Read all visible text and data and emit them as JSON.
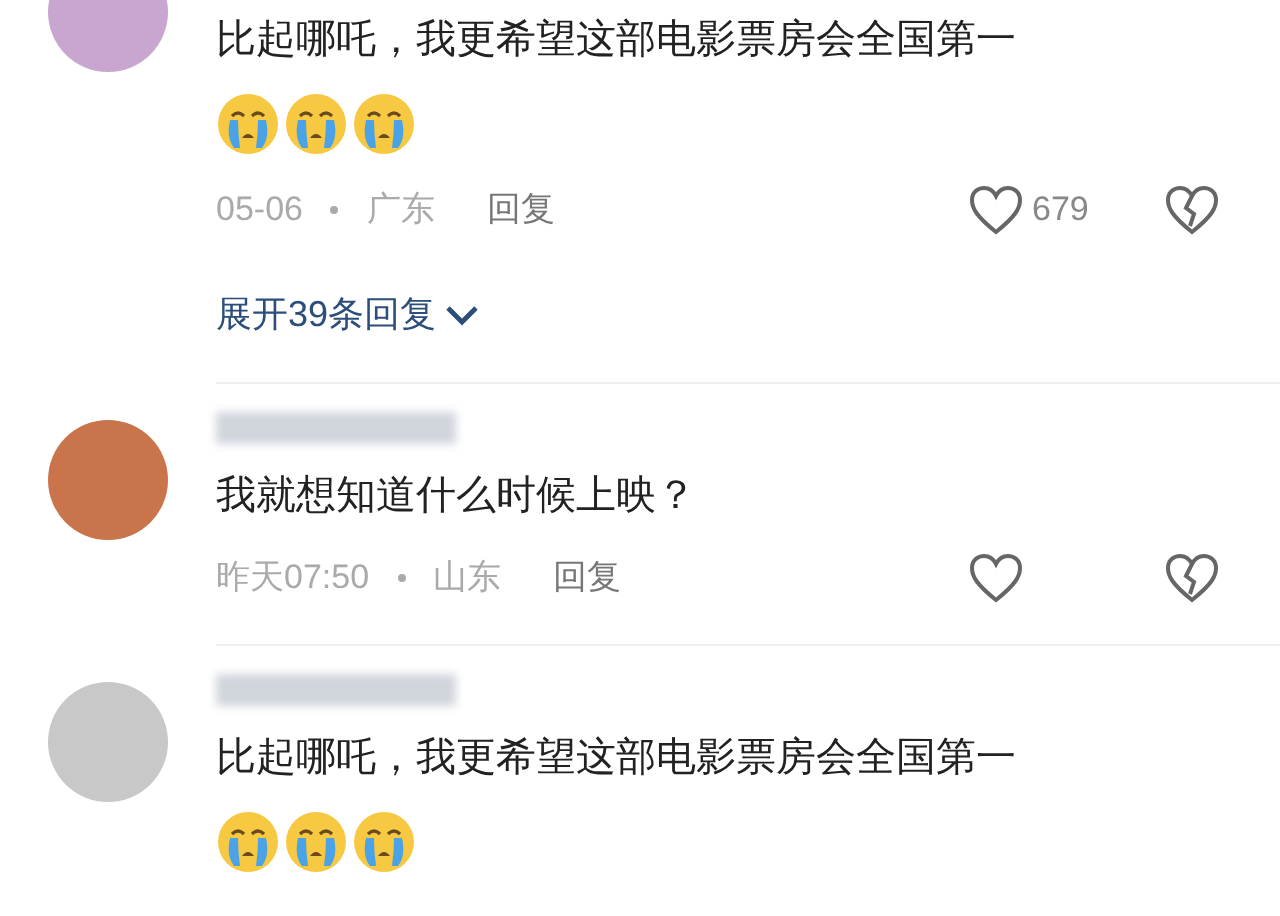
{
  "comments": [
    {
      "avatar": {
        "color": "#c9a6cf"
      },
      "text": "比起哪吒，我更希望这部电影票房会全国第一",
      "reactions": [
        {
          "kind": "crying"
        },
        {
          "kind": "crying"
        },
        {
          "kind": "crying"
        }
      ],
      "time": "05-06",
      "region": "广东",
      "reply": "回复",
      "likes": "679",
      "expand": "展开39条回复"
    },
    {
      "avatar": {
        "color": "#c9744a"
      },
      "text": "我就想知道什么时候上映？",
      "time": "昨天07:50",
      "region": "山东",
      "reply": "回复"
    },
    {
      "avatar": {
        "color": "#c8c8c8"
      },
      "text": "比起哪吒，我更希望这部电影票房会全国第一",
      "reactions": [
        {
          "kind": "crying"
        },
        {
          "kind": "crying"
        },
        {
          "kind": "crying"
        }
      ]
    }
  ]
}
